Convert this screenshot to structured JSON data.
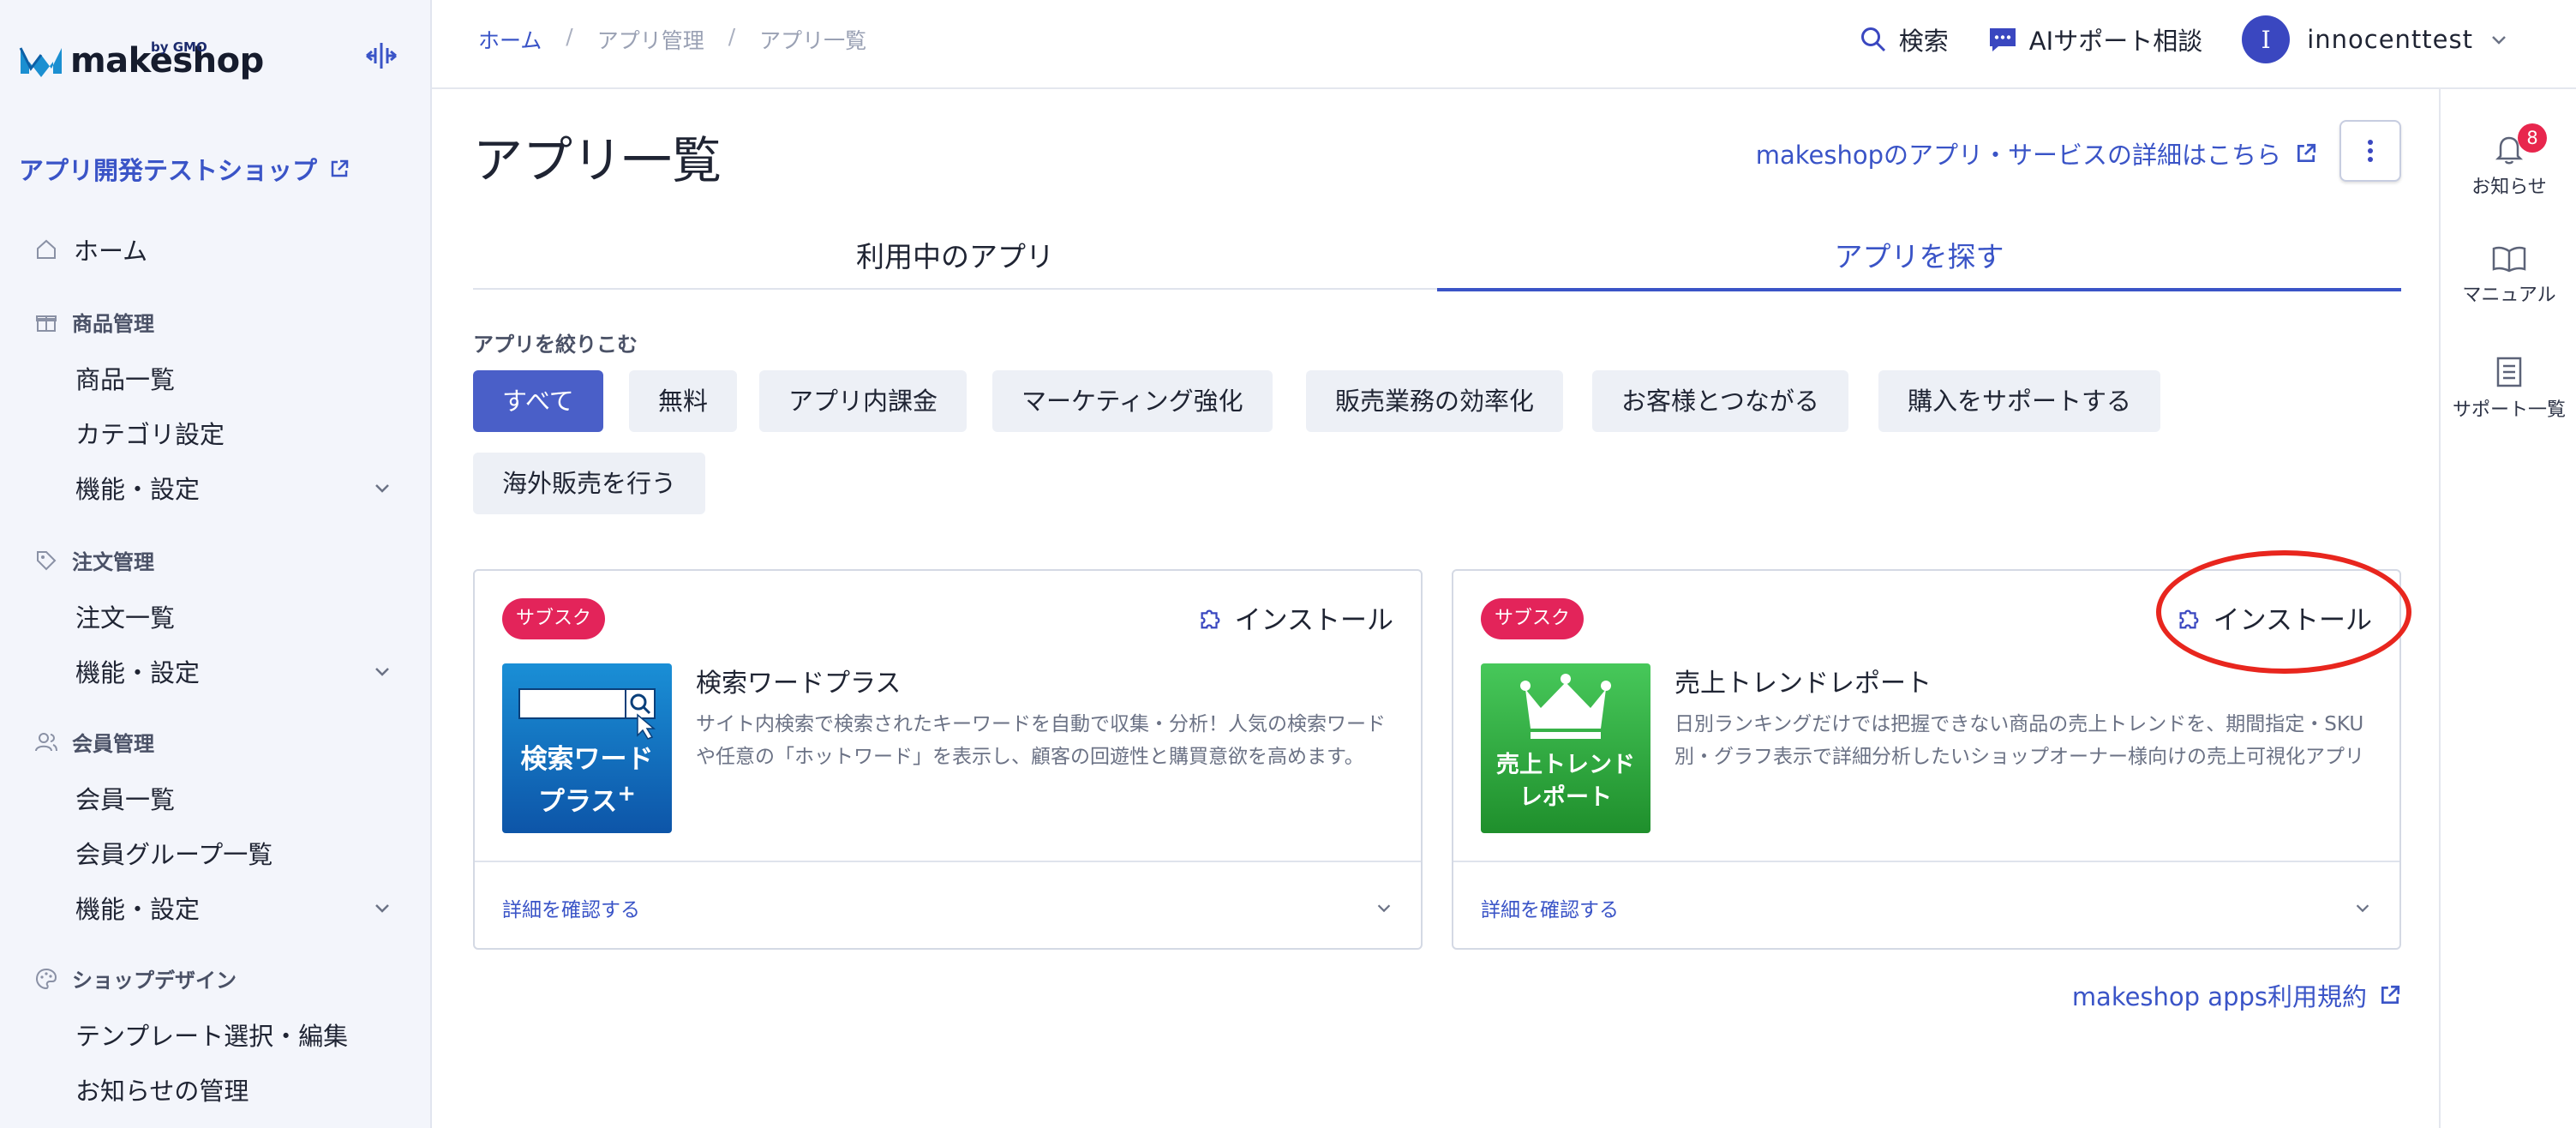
{
  "brand": {
    "logo_text": "makeshop",
    "logo_sub": "by GMO",
    "accent": "#3a54c7"
  },
  "sidebar": {
    "shop_name": "アプリ開発テストショップ",
    "home_label": "ホーム",
    "groups": [
      {
        "label": "商品管理",
        "icon": "gift-icon",
        "items": [
          "商品一覧",
          "カテゴリ設定",
          "機能・設定"
        ]
      },
      {
        "label": "注文管理",
        "icon": "tag-icon",
        "items": [
          "注文一覧",
          "機能・設定"
        ]
      },
      {
        "label": "会員管理",
        "icon": "users-icon",
        "items": [
          "会員一覧",
          "会員グループ一覧",
          "機能・設定"
        ]
      },
      {
        "label": "ショップデザイン",
        "icon": "palette-icon",
        "items": [
          "テンプレート選択・編集",
          "お知らせの管理"
        ]
      }
    ]
  },
  "breadcrumb": [
    "ホーム",
    "アプリ管理",
    "アプリ一覧"
  ],
  "topbar": {
    "search_label": "検索",
    "ai_label": "AIサポート相談",
    "user_initial": "I",
    "user_name": "innocenttest"
  },
  "rightrail": {
    "notifications_label": "お知らせ",
    "notifications_count": "8",
    "manual_label": "マニュアル",
    "support_label": "サポート一覧"
  },
  "main": {
    "title": "アプリ一覧",
    "detail_link": "makeshopのアプリ・サービスの詳細はこちら",
    "tabs": [
      "利用中のアプリ",
      "アプリを探す"
    ],
    "active_tab": "アプリを探す",
    "filter_label": "アプリを絞りこむ",
    "filters": [
      "すべて",
      "無料",
      "アプリ内課金",
      "マーケティング強化",
      "販売業務の効率化",
      "お客様とつながる",
      "購入をサポートする",
      "海外販売を行う"
    ],
    "active_filter": "すべて",
    "cards": [
      {
        "tag": "サブスク",
        "install_label": "インストール",
        "name": "検索ワードプラス",
        "description": "サイト内検索で検索されたキーワードを自動で収集・分析！人気の検索ワードや任意の「ホットワード」を表示し、顧客の回遊性と購買意欲を高めます。",
        "thumb_text_1": "検索ワード",
        "thumb_text_2": "プラス",
        "expand_label": "詳細を確認する"
      },
      {
        "tag": "サブスク",
        "install_label": "インストール",
        "name": "売上トレンドレポート",
        "description": "日別ランキングだけでは把握できない商品の売上トレンドを、期間指定・SKU別・グラフ表示で詳細分析したいショップオーナー様向けの売上可視化アプリです。",
        "thumb_text_1": "売上トレンド",
        "thumb_text_2": "レポート",
        "expand_label": "詳細を確認する"
      }
    ],
    "terms_link": "makeshop apps利用規約"
  }
}
